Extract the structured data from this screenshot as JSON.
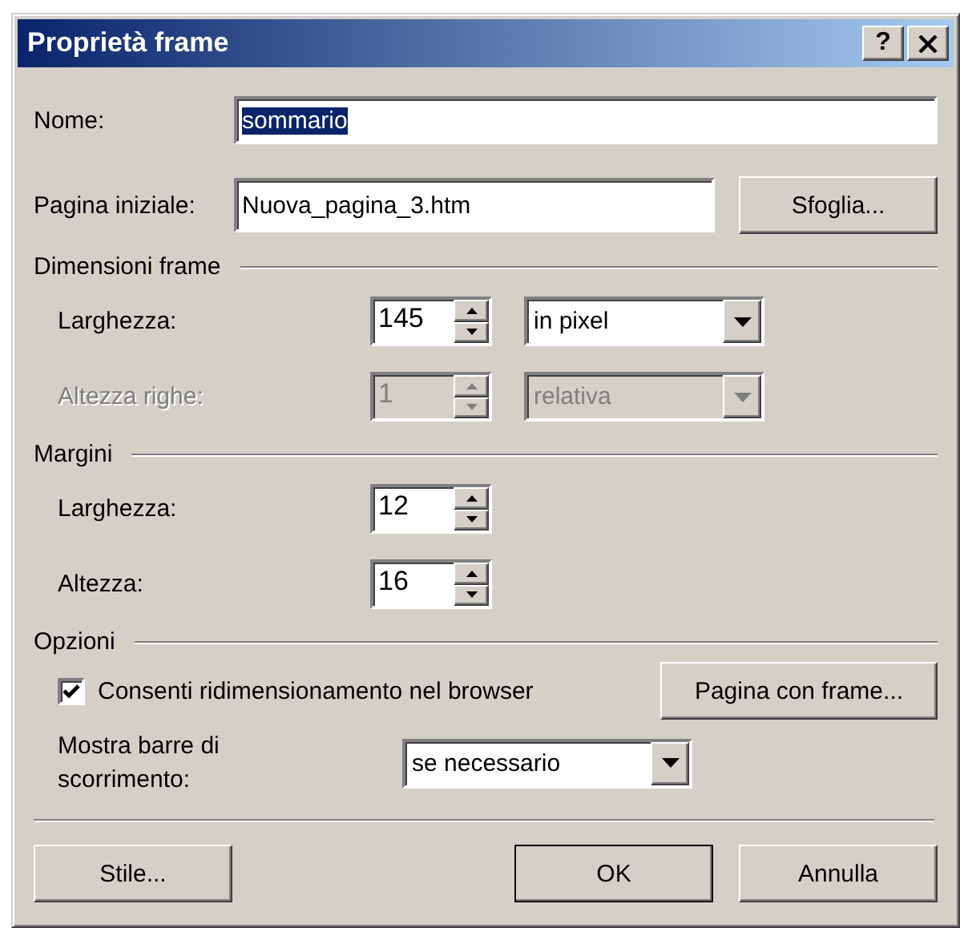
{
  "window": {
    "title": "Proprietà frame",
    "title_buttons": [
      {
        "kind": "help",
        "label": "?"
      },
      {
        "kind": "close"
      }
    ]
  },
  "name_field": {
    "label": "Nome:",
    "value": "sommario",
    "selected": true
  },
  "initial_page": {
    "label": "Pagina iniziale:",
    "value": "Nuova_pagina_3.htm",
    "button": "Sfoglia..."
  },
  "sections": [
    {
      "heading": "Dimensioni frame",
      "rows": [
        {
          "label": "Larghezza:",
          "value": "145",
          "disabled": false,
          "unit": "in pixel"
        },
        {
          "label": "Altezza righe:",
          "value": "1",
          "disabled": true,
          "unit": "relativa"
        }
      ]
    },
    {
      "heading": "Margini",
      "rows": [
        {
          "label": "Larghezza:",
          "value": "12",
          "disabled": false
        },
        {
          "label": "Altezza:",
          "value": "16",
          "disabled": false
        }
      ]
    }
  ],
  "options": {
    "heading": "Opzioni",
    "checkbox": {
      "label": "Consenti ridimensionamento nel browser",
      "checked": true
    },
    "frames_button": "Pagina con frame...",
    "scrollbars": {
      "label": "Mostra barre di scorrimento:",
      "value": "se necessario"
    }
  },
  "left_buttons": [
    {
      "label": "Stile...",
      "default": false
    }
  ],
  "right_buttons": [
    {
      "label": "OK",
      "default": true
    },
    {
      "label": "Annulla",
      "default": false
    }
  ]
}
